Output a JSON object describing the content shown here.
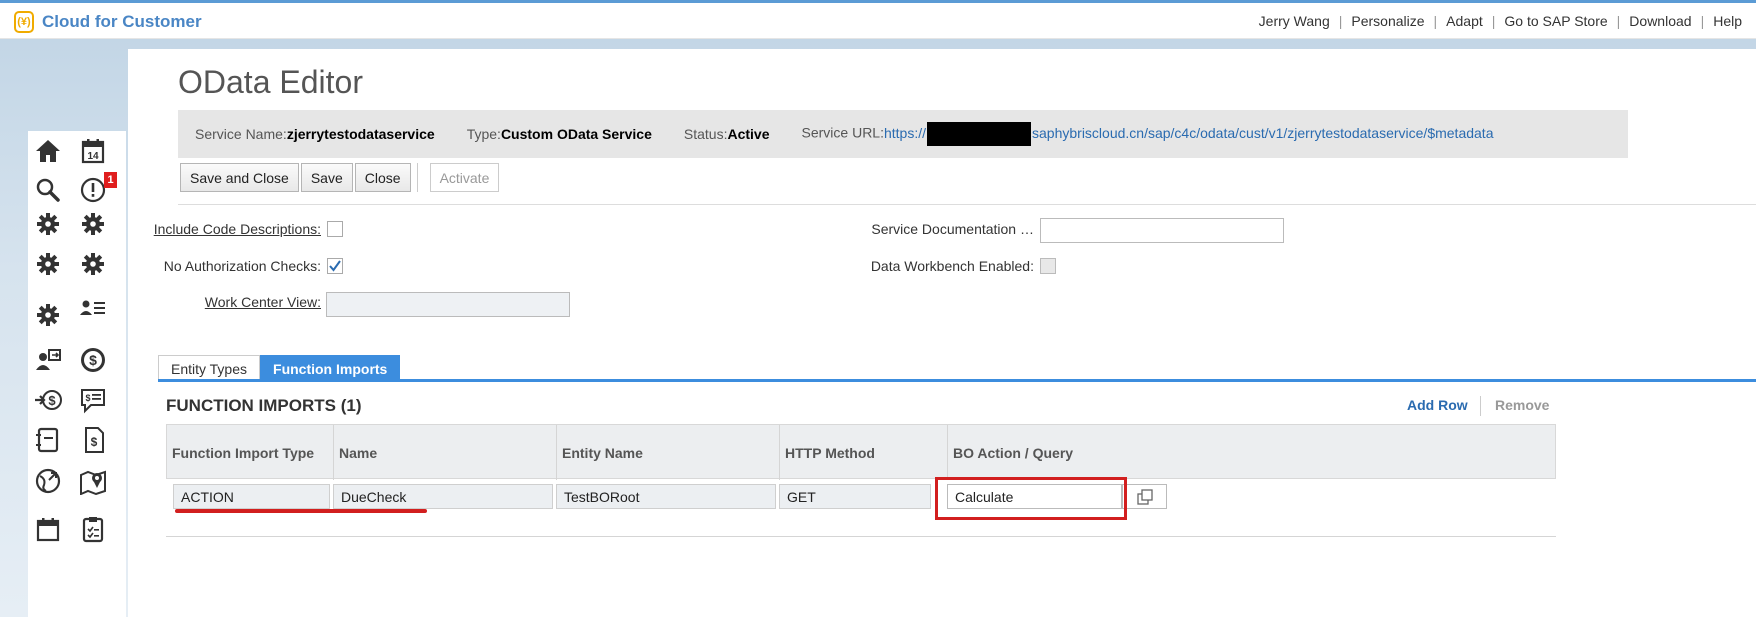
{
  "app": {
    "title": "Cloud for Customer",
    "logo_glyph": "(¥)"
  },
  "topnav": {
    "user": "Jerry Wang",
    "items": [
      "Personalize",
      "Adapt",
      "Go to SAP Store",
      "Download",
      "Help"
    ],
    "separator": "|"
  },
  "sidebar": {
    "icons": [
      "home-icon",
      "calendar-icon",
      "search-icon",
      "alert-icon",
      "gear-icon",
      "gear-icon",
      "gear-icon",
      "gear-icon",
      "gear-icon",
      "contacts-list-icon",
      "person-transfer-icon",
      "dollar-circle-icon",
      "arrow-dollar-icon",
      "chat-dollar-icon",
      "document-icon",
      "invoice-dollar-icon",
      "globe-arrow-icon",
      "map-pin-icon",
      "calendar-icon",
      "clipboard-check-icon"
    ],
    "calendar_day": "14",
    "alert_badge": "1"
  },
  "page": {
    "title": "OData Editor"
  },
  "infobar": {
    "service_name_label": "Service Name:",
    "service_name_value": "zjerrytestodataservice",
    "type_label": "Type:",
    "type_value": "Custom OData Service",
    "status_label": "Status:",
    "status_value": "Active",
    "url_label": "Service URL:",
    "url_prefix": "https://",
    "url_suffix": "saphybriscloud.cn/sap/c4c/odata/cust/v1/zjerrytestodataservice/$metadata"
  },
  "toolbar": {
    "save_close": "Save and Close",
    "save": "Save",
    "close": "Close",
    "activate": "Activate"
  },
  "form": {
    "include_code_desc_label": "Include Code Descriptions:",
    "include_code_desc_checked": false,
    "no_auth_label": "No Authorization Checks:",
    "no_auth_checked": true,
    "work_center_label": "Work Center View:",
    "work_center_value": "",
    "service_doc_label": "Service Documentation …",
    "service_doc_value": "",
    "data_workbench_label": "Data Workbench Enabled:",
    "data_workbench_checked": false
  },
  "tabs": [
    "Entity Types",
    "Function Imports"
  ],
  "active_tab": "Function Imports",
  "section": {
    "title": "FUNCTION IMPORTS (1)",
    "add_row": "Add Row",
    "remove": "Remove"
  },
  "table": {
    "columns": [
      "Function Import Type",
      "Name",
      "Entity Name",
      "HTTP Method",
      "BO Action / Query"
    ],
    "rows": [
      [
        "ACTION",
        "DueCheck",
        "TestBORoot",
        "GET",
        "Calculate"
      ]
    ]
  },
  "colors": {
    "accent": "#3c8dde",
    "link": "#2a6bb0",
    "annotation": "#d21f1f",
    "brand": "#f0ab00"
  }
}
